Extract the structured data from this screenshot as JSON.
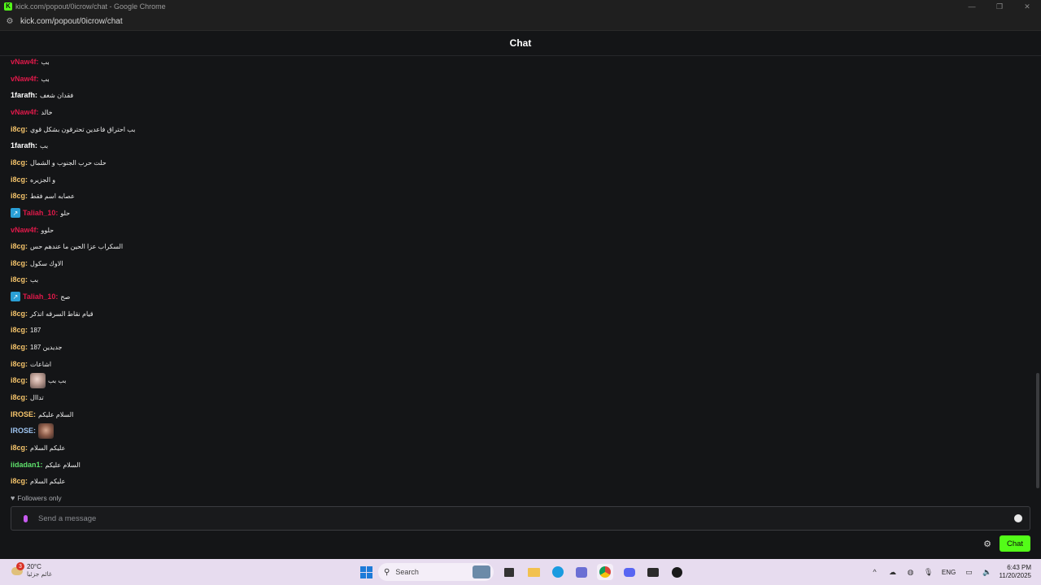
{
  "window": {
    "title": "kick.com/popout/0icrow/chat - Google Chrome",
    "favicon_letter": "K",
    "controls": {
      "minimize": "—",
      "maximize": "❐",
      "close": "✕"
    }
  },
  "address_bar": {
    "url": "kick.com/popout/0icrow/chat"
  },
  "header": {
    "title": "Chat"
  },
  "messages": [
    {
      "user": "vNaw4f",
      "color": "#e0194a",
      "text": "بب"
    },
    {
      "user": "vNaw4f",
      "color": "#e0194a",
      "text": "بب"
    },
    {
      "user": "1farafh",
      "color": "#ffffff",
      "text": "فقدان شغف"
    },
    {
      "user": "vNaw4f",
      "color": "#e0194a",
      "text": "خالد"
    },
    {
      "user": "i8cg",
      "color": "#f5c46b",
      "text": "بب احتراق فاعدين تحترقون بشكل قوي"
    },
    {
      "user": "1farafh",
      "color": "#ffffff",
      "text": "بب"
    },
    {
      "user": "i8cg",
      "color": "#f5c46b",
      "text": "حلت حرب الجنوب و الشمال"
    },
    {
      "user": "i8cg",
      "color": "#f5c46b",
      "text": "و الجزيره"
    },
    {
      "user": "i8cg",
      "color": "#f5c46b",
      "text": "عصابه اسم فقط"
    },
    {
      "user": "Taliah_10",
      "color": "#e0194a",
      "text": "حلو",
      "badge": true
    },
    {
      "user": "vNaw4f",
      "color": "#e0194a",
      "text": "حلوو"
    },
    {
      "user": "i8cg",
      "color": "#f5c46b",
      "text": "السكراب عزا الحين ما عندهم حس"
    },
    {
      "user": "i8cg",
      "color": "#f5c46b",
      "text": "الاوك سكول"
    },
    {
      "user": "i8cg",
      "color": "#f5c46b",
      "text": "بب"
    },
    {
      "user": "Taliah_10",
      "color": "#e0194a",
      "text": "صح",
      "badge": true
    },
    {
      "user": "i8cg",
      "color": "#f5c46b",
      "text": "قيام نقاط السرقه اتذكر"
    },
    {
      "user": "i8cg",
      "color": "#f5c46b",
      "text": "187"
    },
    {
      "user": "i8cg",
      "color": "#f5c46b",
      "text": "جديدين 187"
    },
    {
      "user": "i8cg",
      "color": "#f5c46b",
      "text": "اشاعات"
    },
    {
      "user": "i8cg",
      "color": "#f5c46b",
      "text": "بب بب",
      "emote": "e1"
    },
    {
      "user": "i8cg",
      "color": "#f5c46b",
      "text": "تداال"
    },
    {
      "user": "IROSE",
      "color": "#f5c46b",
      "text": "السلام عليكم"
    },
    {
      "user": "IROSE",
      "color": "#9ec4f0",
      "text": "",
      "emote": "e2"
    },
    {
      "user": "i8cg",
      "color": "#f5c46b",
      "text": "عليكم السلام"
    },
    {
      "user": "iidadan1",
      "color": "#5ee06b",
      "text": "السلام عليكم"
    },
    {
      "user": "i8cg",
      "color": "#f5c46b",
      "text": "عليكم السلام"
    }
  ],
  "followers_only": {
    "label": "Followers only"
  },
  "input": {
    "placeholder": "Send a message"
  },
  "send_button": {
    "label": "Chat"
  },
  "taskbar": {
    "weather": {
      "badge": "3",
      "temp": "20°C",
      "condition": "غائم جزئيا"
    },
    "search_label": "Search",
    "tray": {
      "lang": "ENG",
      "time": "6:43 PM",
      "date": "11/20/2025"
    }
  }
}
